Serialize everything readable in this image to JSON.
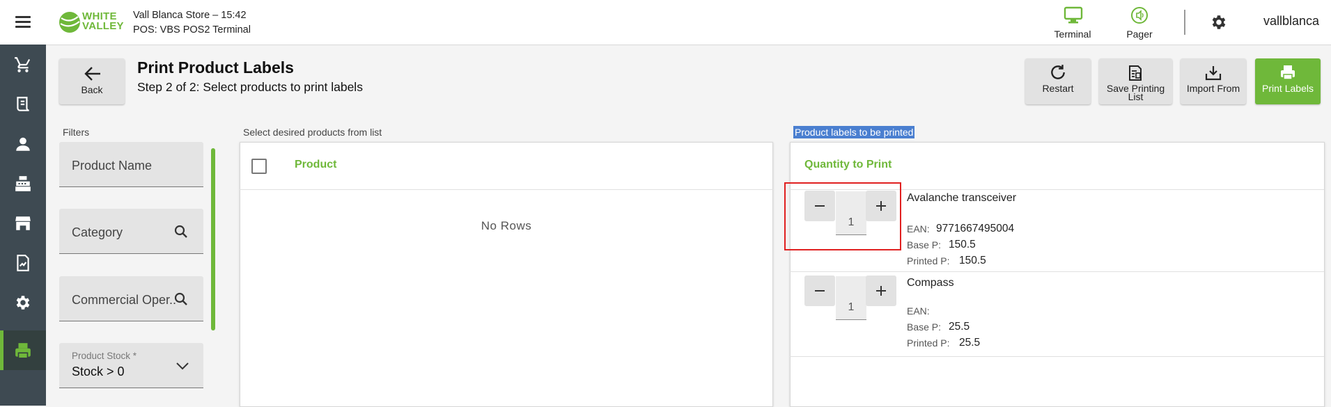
{
  "header": {
    "logo_line1": "WHITE",
    "logo_line2": "VALLEY",
    "store_line": "Vall Blanca Store – 15:42",
    "pos_line": "POS: VBS POS2 Terminal",
    "terminal_label": "Terminal",
    "pager_label": "Pager",
    "username": "vallblanca"
  },
  "colors": {
    "accent": "#6fb83a",
    "sidebar": "#3e4a52",
    "highlight": "#e02020",
    "selection": "#4a7fd0"
  },
  "sidebar": {
    "items": [
      {
        "icon": "cart-icon"
      },
      {
        "icon": "receipt-icon"
      },
      {
        "icon": "person-icon"
      },
      {
        "icon": "cash-register-icon"
      },
      {
        "icon": "store-icon"
      },
      {
        "icon": "report-icon"
      },
      {
        "icon": "gear-icon"
      },
      {
        "icon": "label-printer-icon",
        "active": true
      }
    ]
  },
  "page": {
    "back_label": "Back",
    "title": "Print Product Labels",
    "subtitle": "Step 2 of 2: Select products to print labels",
    "actions": {
      "restart": "Restart",
      "save_line1": "Save Printing",
      "save_line2": "List",
      "import": "Import From",
      "print": "Print Labels"
    }
  },
  "filters": {
    "title": "Filters",
    "product_name_placeholder": "Product Name",
    "category_placeholder": "Category",
    "commercial_placeholder": "Commercial Oper...",
    "stock_label": "Product Stock *",
    "stock_value": "Stock > 0"
  },
  "product_list": {
    "title": "Select desired products from list",
    "column_product": "Product",
    "empty_text": "No Rows"
  },
  "labels_panel": {
    "title": "Product labels to be printed",
    "column_quantity": "Quantity to Print",
    "ean_label": "EAN:",
    "base_label": "Base P:",
    "printed_label": "Printed P:",
    "items": [
      {
        "name": "Avalanche transceiver",
        "quantity": "1",
        "ean": "9771667495004",
        "base_price": "150.5",
        "printed_price": "150.5"
      },
      {
        "name": "Compass",
        "quantity": "1",
        "ean": "",
        "base_price": "25.5",
        "printed_price": "25.5"
      }
    ]
  }
}
